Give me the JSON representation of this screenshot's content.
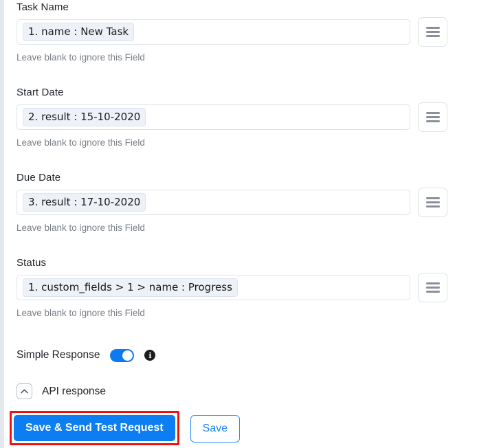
{
  "fields": [
    {
      "label": "Task Name",
      "token": "1. name : New Task",
      "helper": "Leave blank to ignore this Field",
      "menu_icon": "hamburger-icon"
    },
    {
      "label": "Start Date",
      "token": "2. result : 15-10-2020",
      "helper": "Leave blank to ignore this Field",
      "menu_icon": "hamburger-icon"
    },
    {
      "label": "Due Date",
      "token": "3. result : 17-10-2020",
      "helper": "Leave blank to ignore this Field",
      "menu_icon": "hamburger-icon"
    },
    {
      "label": "Status",
      "token": "1. custom_fields > 1 > name : Progress",
      "helper": "Leave blank to ignore this Field",
      "menu_icon": "hamburger-icon"
    }
  ],
  "simple_response": {
    "label": "Simple Response",
    "toggle_state": "on",
    "info_icon": "info-icon",
    "info_glyph": "i"
  },
  "api_response": {
    "label": "API response",
    "collapse_icon": "chevron-up-icon",
    "expanded": true
  },
  "footer": {
    "primary_label": "Save & Send Test Request",
    "secondary_label": "Save"
  },
  "colors": {
    "accent_blue": "#0d7df2",
    "toggle_blue": "#0d79f2",
    "annotation_red": "#f21111",
    "helper_gray": "#7a8088",
    "token_bg": "#eef2f8",
    "border_gray": "#dfe3e8"
  }
}
